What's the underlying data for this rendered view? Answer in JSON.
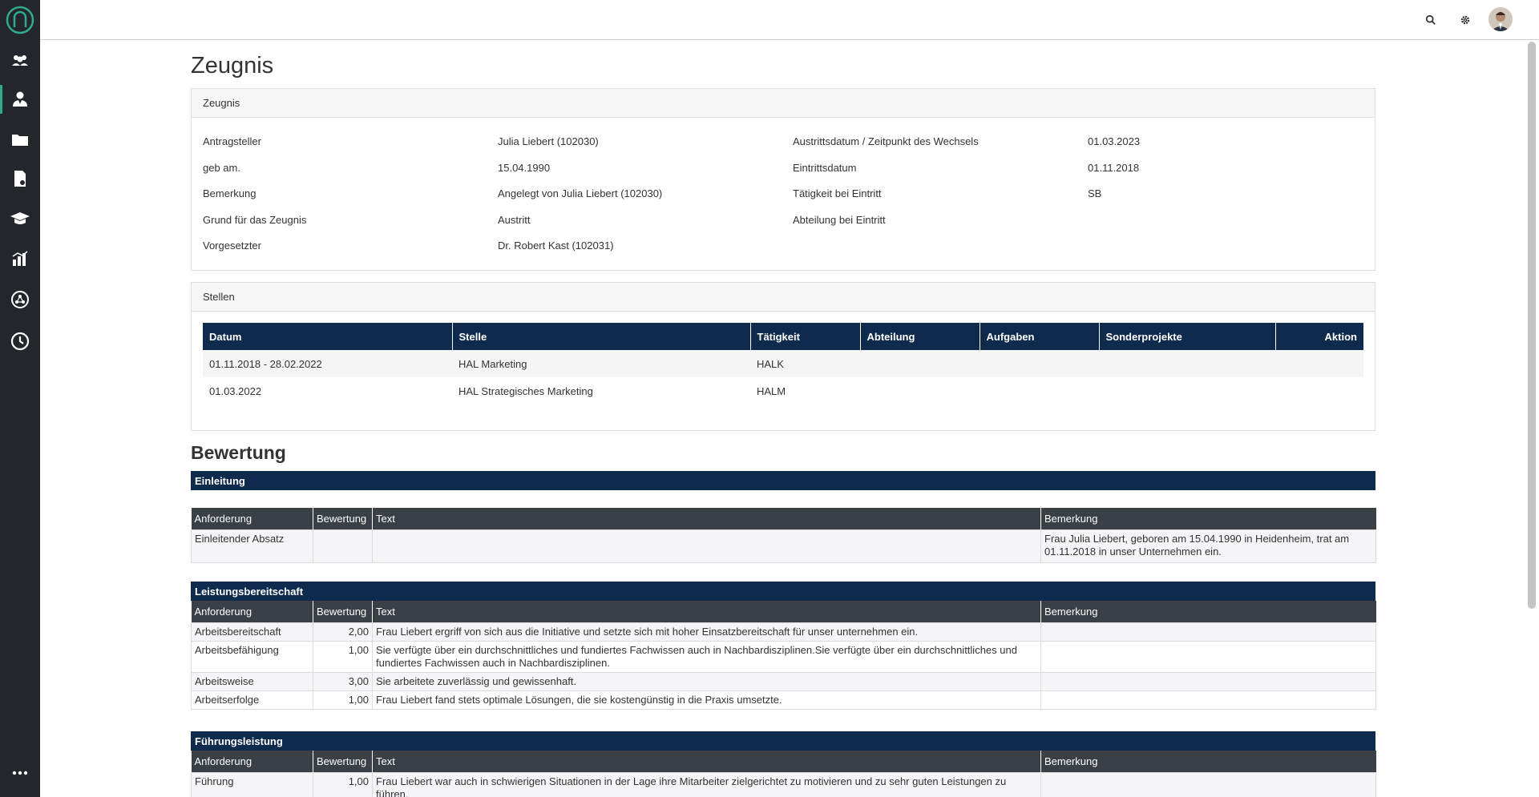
{
  "page_title": "Zeugnis",
  "card_zeugnis": {
    "header": "Zeugnis",
    "left": [
      {
        "label": "Antragsteller",
        "value": "Julia Liebert (102030)"
      },
      {
        "label": "geb am.",
        "value": "15.04.1990"
      },
      {
        "label": "Bemerkung",
        "value": "Angelegt von Julia Liebert (102030)"
      },
      {
        "label": "Grund für das Zeugnis",
        "value": "Austritt"
      },
      {
        "label": "Vorgesetzter",
        "value": "Dr. Robert Kast (102031)"
      }
    ],
    "right": [
      {
        "label": "Austrittsdatum / Zeitpunkt des Wechsels",
        "value": "01.03.2023"
      },
      {
        "label": "Eintrittsdatum",
        "value": "01.11.2018"
      },
      {
        "label": "Tätigkeit bei Eintritt",
        "value": "SB"
      },
      {
        "label": "Abteilung bei Eintritt",
        "value": ""
      }
    ]
  },
  "card_stellen": {
    "header": "Stellen",
    "columns": [
      "Datum",
      "Stelle",
      "Tätigkeit",
      "Abteilung",
      "Aufgaben",
      "Sonderprojekte",
      "Aktion"
    ],
    "rows": [
      [
        "01.11.2018 - 28.02.2022",
        "HAL Marketing",
        "HALK",
        "",
        "",
        "",
        ""
      ],
      [
        "01.03.2022",
        "HAL Strategisches Marketing",
        "HALM",
        "",
        "",
        "",
        ""
      ]
    ]
  },
  "bewertung": {
    "title": "Bewertung",
    "columns": [
      "Anforderung",
      "Bewertung",
      "Text",
      "Bemerkung"
    ],
    "einleitung": {
      "title": "Einleitung",
      "rows": [
        {
          "anforderung": "Einleitender Absatz",
          "bewertung": "",
          "text": "",
          "bemerkung": "Frau Julia Liebert, geboren am 15.04.1990 in Heidenheim, trat am 01.11.2018 in unser Unternehmen ein."
        }
      ]
    },
    "leistungsbereitschaft": {
      "title": "Leistungsbereitschaft",
      "rows": [
        {
          "anforderung": "Arbeitsbereitschaft",
          "bewertung": "2,00",
          "text": "Frau Liebert ergriff von sich aus die Initiative und setzte sich mit hoher Einsatzbereitschaft für unser unternehmen ein.",
          "bemerkung": ""
        },
        {
          "anforderung": "Arbeitsbefähigung",
          "bewertung": "1,00",
          "text": "Sie verfügte über ein durchschnittliches und fundiertes Fachwissen auch in Nachbardisziplinen.Sie verfügte über ein durchschnittliches und fundiertes Fachwissen auch in Nachbardisziplinen.",
          "bemerkung": ""
        },
        {
          "anforderung": "Arbeitsweise",
          "bewertung": "3,00",
          "text": "Sie arbeitete zuverlässig und gewissenhaft.",
          "bemerkung": ""
        },
        {
          "anforderung": "Arbeitserfolge",
          "bewertung": "1,00",
          "text": "Frau Liebert fand stets optimale Lösungen, die sie kostengünstig in die Praxis umsetzte.",
          "bemerkung": ""
        }
      ]
    },
    "fuehrungsleistung": {
      "title": "Führungsleistung",
      "rows": [
        {
          "anforderung": "Führung",
          "bewertung": "1,00",
          "text": "Frau Liebert war auch in schwierigen Situationen in der Lage ihre Mitarbeiter zielgerichtet zu motivieren und zu sehr guten Leistungen zu führen.",
          "bemerkung": ""
        }
      ]
    }
  },
  "icons": {
    "sidebar": [
      "logo-icon",
      "team-icon",
      "person-icon",
      "folder-icon",
      "document-icon",
      "graduation-icon",
      "chart-icon",
      "network-icon",
      "clock-icon",
      "more-icon"
    ],
    "topbar": [
      "search-icon",
      "gear-icon",
      "avatar"
    ]
  },
  "colors": {
    "sidebar_bg": "#23262b",
    "accent": "#2eaa8f",
    "table_header": "#0e2a4d",
    "subheader": "#3b3f46"
  }
}
